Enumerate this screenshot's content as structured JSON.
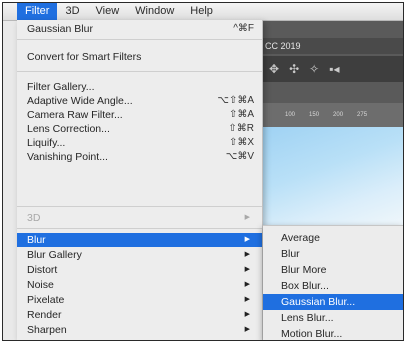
{
  "menubar": {
    "items": [
      "Filter",
      "3D",
      "View",
      "Window",
      "Help"
    ],
    "active": "Filter"
  },
  "app": {
    "tab_title": "CC 2019",
    "ruler_ticks": [
      "100",
      "150",
      "200",
      "275"
    ],
    "tool_icons": [
      "move-icon",
      "zoom-icon",
      "pan-icon",
      "camera-icon"
    ]
  },
  "filter_menu": {
    "last_filter": {
      "label": "Gaussian Blur",
      "shortcut": "^⌘F"
    },
    "convert": {
      "label": "Convert for Smart Filters"
    },
    "gallery_items": [
      {
        "label": "Filter Gallery...",
        "shortcut": ""
      },
      {
        "label": "Adaptive Wide Angle...",
        "shortcut": "⌥⇧⌘A"
      },
      {
        "label": "Camera Raw Filter...",
        "shortcut": "⇧⌘A"
      },
      {
        "label": "Lens Correction...",
        "shortcut": "⇧⌘R"
      },
      {
        "label": "Liquify...",
        "shortcut": "⇧⌘X"
      },
      {
        "label": "Vanishing Point...",
        "shortcut": "⌥⌘V"
      }
    ],
    "disabled_item": {
      "label": "3D"
    },
    "submenus": [
      "Blur",
      "Blur Gallery",
      "Distort",
      "Noise",
      "Pixelate",
      "Render",
      "Sharpen"
    ],
    "highlighted_submenu": "Blur"
  },
  "blur_submenu": {
    "items": [
      "Average",
      "Blur",
      "Blur More",
      "Box Blur...",
      "Gaussian Blur...",
      "Lens Blur...",
      "Motion Blur..."
    ],
    "highlighted": "Gaussian Blur..."
  },
  "colors": {
    "highlight": "#1f6fe0",
    "menu_bg": "#ededed",
    "app_bg": "#5a5a5a"
  }
}
